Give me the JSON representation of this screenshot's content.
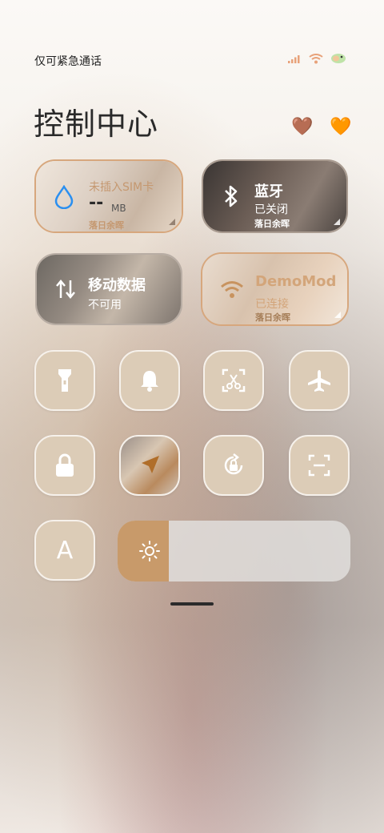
{
  "status_bar": {
    "carrier_text": "仅可紧急通话"
  },
  "header": {
    "title": "控制中心",
    "icons": [
      "brown-heart-icon",
      "orange-heart-icon"
    ]
  },
  "tiles": {
    "data_usage": {
      "title": "未插入SIM卡",
      "value": "--",
      "unit": "MB",
      "theme": "落日余晖"
    },
    "bluetooth": {
      "title": "蓝牙",
      "status": "已关闭",
      "theme": "落日余晖"
    },
    "mobile_data": {
      "title": "移动数据",
      "status": "不可用"
    },
    "wifi": {
      "title": "DemoMod",
      "status": "已连接",
      "theme": "落日余晖"
    }
  },
  "toggles": [
    "flashlight-icon",
    "bell-icon",
    "screenshot-cut-icon",
    "airplane-icon",
    "lock-icon",
    "location-arrow-icon",
    "rotation-lock-icon",
    "scan-icon"
  ],
  "font_button": {
    "label": "A"
  },
  "brightness": {
    "level": 0.22
  },
  "colors": {
    "accent": "#c89a6a",
    "tile": "#dcccb7",
    "blue": "#2a8ff0"
  }
}
